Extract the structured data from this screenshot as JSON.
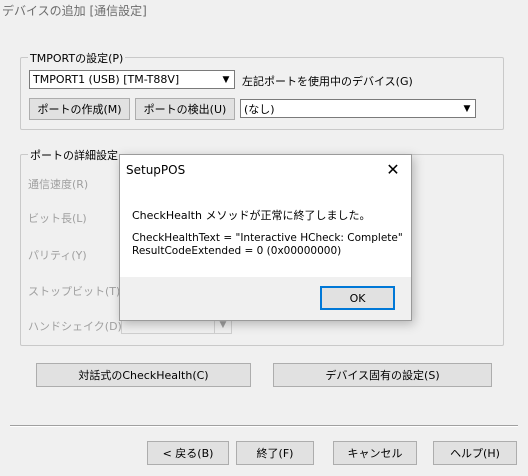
{
  "window": {
    "title": "デバイスの追加 [通信設定]"
  },
  "tmport_group": {
    "legend": "TMPORTの設定(P)",
    "port_select": "TMPORT1 (USB) [TM-T88V]",
    "device_label": "左記ポートを使用中のデバイス(G)",
    "create_port_button": "ポートの作成(M)",
    "detect_port_button": "ポートの検出(U)",
    "device_select": "(なし)"
  },
  "port_detail_group": {
    "legend": "ポートの詳細設定",
    "fields": [
      {
        "label": "通信速度(R)"
      },
      {
        "label": "ビット長(L)"
      },
      {
        "label": "パリティ(Y)"
      },
      {
        "label": "ストップビット(T)"
      },
      {
        "label": "ハンドシェイク(D)"
      }
    ]
  },
  "buttons": {
    "checkhealth": "対話式のCheckHealth(C)",
    "device_settings": "デバイス固有の設定(S)",
    "back": "< 戻る(B)",
    "finish": "終了(F)",
    "cancel": "キャンセル",
    "help": "ヘルプ(H)"
  },
  "dialog": {
    "title": "SetupPOS",
    "message": "CheckHealth メソッドが正常に終了しました。",
    "detail_line1": "CheckHealthText = \"Interactive HCheck: Complete\"",
    "detail_line2": "ResultCodeExtended = 0 (0x00000000)",
    "ok_button": "OK"
  },
  "icons": {
    "close": "close-icon",
    "dropdown": "chevron-down-icon"
  }
}
